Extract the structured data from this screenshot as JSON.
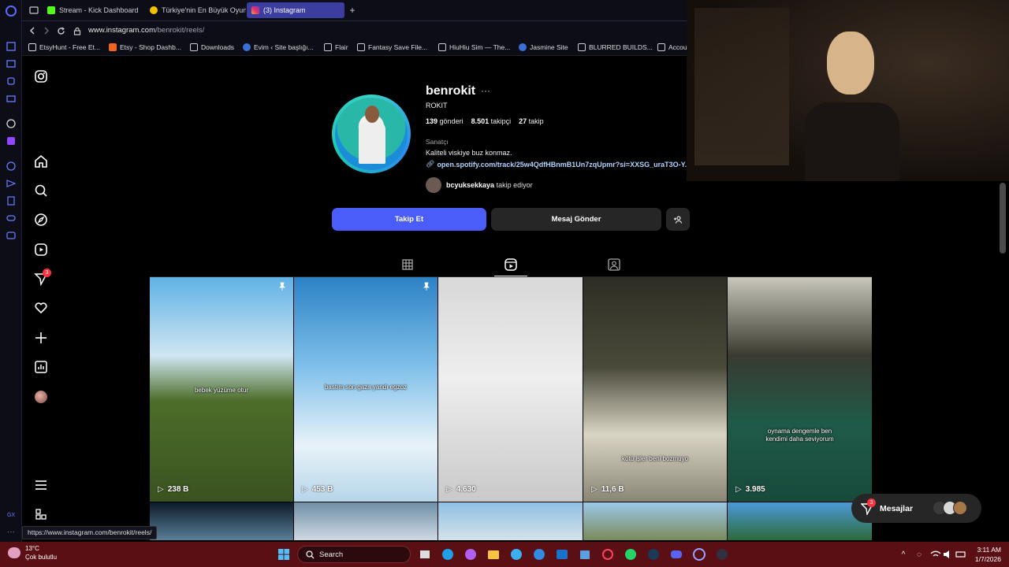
{
  "browser": {
    "tabs": [
      {
        "title": "Stream - Kick Dashboard",
        "fav_color": "#53fc18"
      },
      {
        "title": "Türkiye'nin En Büyük Oyun",
        "fav_color": "#f2c200"
      },
      {
        "title": "(3) Instagram",
        "fav_color": "#e1306c"
      }
    ],
    "address": {
      "domain": "www.instagram.com",
      "path": "/benrokit/reels/"
    },
    "bookmarks": [
      {
        "label": "EtsyHunt - Free Et...",
        "color": "#f4f4f4"
      },
      {
        "label": "Etsy - Shop Dashb...",
        "color": "#f1641e"
      },
      {
        "label": "Downloads",
        "color": "#cccccc"
      },
      {
        "label": "Evim ‹ Site başlığı...",
        "color": "#3b6fd8"
      },
      {
        "label": "Flair",
        "color": "#cccccc"
      },
      {
        "label": "Fantasy Save File...",
        "color": "#cccccc"
      },
      {
        "label": "HiuHiu Sim — The...",
        "color": "#cccccc"
      },
      {
        "label": "Jasmine Site",
        "color": "#3b6fd8"
      },
      {
        "label": "BLURRED BUILDS...",
        "color": "#cccccc"
      },
      {
        "label": "Accou",
        "color": "#cccccc"
      }
    ],
    "status_url": "https://www.instagram.com/benrokit/reels/"
  },
  "instagram": {
    "nav": {
      "notification_badge": "3"
    },
    "profile": {
      "username": "benrokit",
      "full_name": "ROKIT",
      "posts_count": "139",
      "posts_label": "gönderi",
      "followers_count": "8.501",
      "followers_label": "takipçi",
      "following_count": "27",
      "following_label": "takip",
      "category": "Sanatçı",
      "bio": "Kaliteli viskiye buz konmaz.",
      "link": "open.spotify.com/track/25w4QdfHBnmB1Un7zqUpmr?si=XXSG_uraT3O-Y...",
      "followed_by_user": "bcyuksekkaya",
      "followed_by_suffix": "takip ediyor"
    },
    "actions": {
      "follow": "Takip Et",
      "message": "Mesaj Gönder",
      "suggest": "+Å"
    },
    "reels": [
      {
        "caption": "bebek yüzüme otur",
        "views": "238 B",
        "pinned": true
      },
      {
        "caption": "bastım son gaza yandı egzoz",
        "views": "453 B",
        "pinned": true
      },
      {
        "caption": "",
        "views": "4.630",
        "pinned": false
      },
      {
        "caption": "kötü işler beni bozmuyo",
        "views": "11,6 B",
        "pinned": false
      },
      {
        "caption": "oynama dengemle ben kendimi daha seviyorum",
        "views": "3.985",
        "pinned": false
      }
    ],
    "messages": {
      "label": "Mesajlar",
      "badge": "3"
    }
  },
  "taskbar": {
    "weather_temp": "13°C",
    "weather_desc": "Çok bulutlu",
    "search_placeholder": "Search",
    "time": "3:11 AM",
    "date": "1/7/2026"
  },
  "colors": {
    "accent": "#4a5df9",
    "taskbar": "#5a0f14"
  }
}
